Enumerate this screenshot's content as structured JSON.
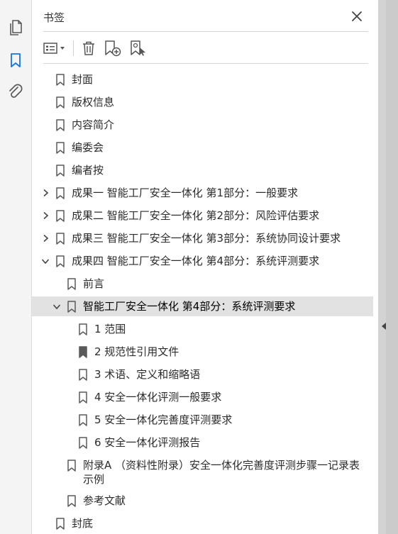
{
  "panel": {
    "title": "书签"
  },
  "left_strip": {
    "buttons": [
      {
        "name": "pages-thumbnails-icon"
      },
      {
        "name": "bookmarks-icon"
      },
      {
        "name": "attachments-icon"
      }
    ]
  },
  "toolbar": {
    "buttons": [
      "options-menu-icon",
      "delete-bookmark-icon",
      "new-bookmark-icon",
      "new-bookmark-from-structure-icon"
    ]
  },
  "bookmarks": {
    "items": [
      {
        "label": "封面",
        "level": 0,
        "caret": "none"
      },
      {
        "label": "版权信息",
        "level": 0,
        "caret": "none"
      },
      {
        "label": "内容简介",
        "level": 0,
        "caret": "none"
      },
      {
        "label": "编委会",
        "level": 0,
        "caret": "none"
      },
      {
        "label": "编者按",
        "level": 0,
        "caret": "none"
      },
      {
        "label": "成果一 智能工厂安全一体化 第1部分：一般要求",
        "level": 0,
        "caret": "collapsed"
      },
      {
        "label": "成果二 智能工厂安全一体化 第2部分：风险评估要求",
        "level": 0,
        "caret": "collapsed"
      },
      {
        "label": "成果三 智能工厂安全一体化 第3部分：系统协同设计要求",
        "level": 0,
        "caret": "collapsed"
      },
      {
        "label": "成果四 智能工厂安全一体化 第4部分：系统评测要求",
        "level": 0,
        "caret": "expanded"
      },
      {
        "label": "前言",
        "level": 1,
        "caret": "none"
      },
      {
        "label": "智能工厂安全一体化 第4部分：系统评测要求",
        "level": 1,
        "caret": "expanded",
        "selected": true
      },
      {
        "label": "1 范围",
        "level": 2,
        "caret": "none"
      },
      {
        "label": "2 规范性引用文件",
        "level": 2,
        "caret": "none",
        "dark": true
      },
      {
        "label": "3 术语、定义和缩略语",
        "level": 2,
        "caret": "none"
      },
      {
        "label": "4 安全一体化评测一般要求",
        "level": 2,
        "caret": "none"
      },
      {
        "label": "5 安全一体化完善度评测要求",
        "level": 2,
        "caret": "none"
      },
      {
        "label": "6 安全一体化评测报告",
        "level": 2,
        "caret": "none"
      },
      {
        "label": "附录A （资料性附录）安全一体化完善度评测步骤一记录表示例",
        "level": 1,
        "caret": "none",
        "wrap": true
      },
      {
        "label": "参考文献",
        "level": 1,
        "caret": "none"
      },
      {
        "label": "封底",
        "level": 0,
        "caret": "none"
      }
    ]
  },
  "colors": {
    "accent": "#1473e6",
    "selected_row": "#e2e2e2",
    "icon": "#5a5a5a"
  }
}
